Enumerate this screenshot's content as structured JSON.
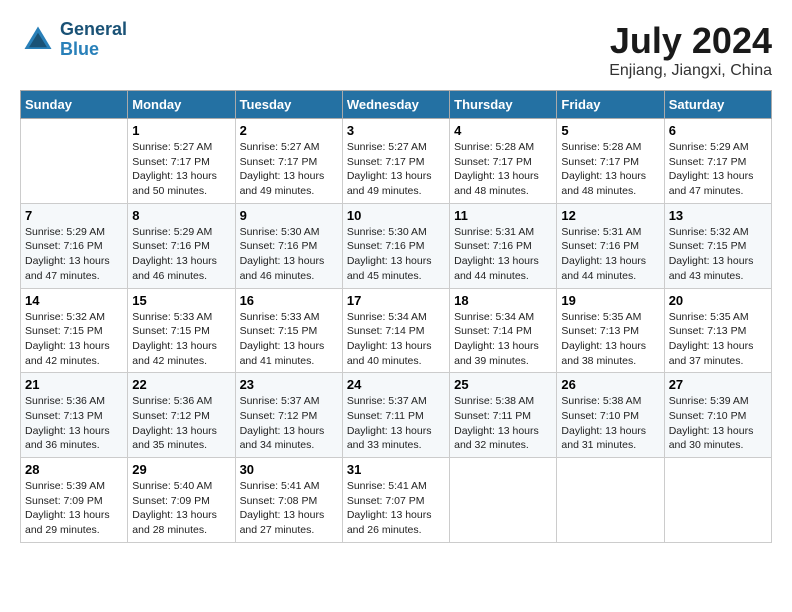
{
  "header": {
    "logo_line1": "General",
    "logo_line2": "Blue",
    "month": "July 2024",
    "location": "Enjiang, Jiangxi, China"
  },
  "weekdays": [
    "Sunday",
    "Monday",
    "Tuesday",
    "Wednesday",
    "Thursday",
    "Friday",
    "Saturday"
  ],
  "weeks": [
    [
      {
        "day": "",
        "empty": true
      },
      {
        "day": "1",
        "sunrise": "Sunrise: 5:27 AM",
        "sunset": "Sunset: 7:17 PM",
        "daylight": "Daylight: 13 hours and 50 minutes."
      },
      {
        "day": "2",
        "sunrise": "Sunrise: 5:27 AM",
        "sunset": "Sunset: 7:17 PM",
        "daylight": "Daylight: 13 hours and 49 minutes."
      },
      {
        "day": "3",
        "sunrise": "Sunrise: 5:27 AM",
        "sunset": "Sunset: 7:17 PM",
        "daylight": "Daylight: 13 hours and 49 minutes."
      },
      {
        "day": "4",
        "sunrise": "Sunrise: 5:28 AM",
        "sunset": "Sunset: 7:17 PM",
        "daylight": "Daylight: 13 hours and 48 minutes."
      },
      {
        "day": "5",
        "sunrise": "Sunrise: 5:28 AM",
        "sunset": "Sunset: 7:17 PM",
        "daylight": "Daylight: 13 hours and 48 minutes."
      },
      {
        "day": "6",
        "sunrise": "Sunrise: 5:29 AM",
        "sunset": "Sunset: 7:17 PM",
        "daylight": "Daylight: 13 hours and 47 minutes."
      }
    ],
    [
      {
        "day": "7",
        "sunrise": "Sunrise: 5:29 AM",
        "sunset": "Sunset: 7:16 PM",
        "daylight": "Daylight: 13 hours and 47 minutes."
      },
      {
        "day": "8",
        "sunrise": "Sunrise: 5:29 AM",
        "sunset": "Sunset: 7:16 PM",
        "daylight": "Daylight: 13 hours and 46 minutes."
      },
      {
        "day": "9",
        "sunrise": "Sunrise: 5:30 AM",
        "sunset": "Sunset: 7:16 PM",
        "daylight": "Daylight: 13 hours and 46 minutes."
      },
      {
        "day": "10",
        "sunrise": "Sunrise: 5:30 AM",
        "sunset": "Sunset: 7:16 PM",
        "daylight": "Daylight: 13 hours and 45 minutes."
      },
      {
        "day": "11",
        "sunrise": "Sunrise: 5:31 AM",
        "sunset": "Sunset: 7:16 PM",
        "daylight": "Daylight: 13 hours and 44 minutes."
      },
      {
        "day": "12",
        "sunrise": "Sunrise: 5:31 AM",
        "sunset": "Sunset: 7:16 PM",
        "daylight": "Daylight: 13 hours and 44 minutes."
      },
      {
        "day": "13",
        "sunrise": "Sunrise: 5:32 AM",
        "sunset": "Sunset: 7:15 PM",
        "daylight": "Daylight: 13 hours and 43 minutes."
      }
    ],
    [
      {
        "day": "14",
        "sunrise": "Sunrise: 5:32 AM",
        "sunset": "Sunset: 7:15 PM",
        "daylight": "Daylight: 13 hours and 42 minutes."
      },
      {
        "day": "15",
        "sunrise": "Sunrise: 5:33 AM",
        "sunset": "Sunset: 7:15 PM",
        "daylight": "Daylight: 13 hours and 42 minutes."
      },
      {
        "day": "16",
        "sunrise": "Sunrise: 5:33 AM",
        "sunset": "Sunset: 7:15 PM",
        "daylight": "Daylight: 13 hours and 41 minutes."
      },
      {
        "day": "17",
        "sunrise": "Sunrise: 5:34 AM",
        "sunset": "Sunset: 7:14 PM",
        "daylight": "Daylight: 13 hours and 40 minutes."
      },
      {
        "day": "18",
        "sunrise": "Sunrise: 5:34 AM",
        "sunset": "Sunset: 7:14 PM",
        "daylight": "Daylight: 13 hours and 39 minutes."
      },
      {
        "day": "19",
        "sunrise": "Sunrise: 5:35 AM",
        "sunset": "Sunset: 7:13 PM",
        "daylight": "Daylight: 13 hours and 38 minutes."
      },
      {
        "day": "20",
        "sunrise": "Sunrise: 5:35 AM",
        "sunset": "Sunset: 7:13 PM",
        "daylight": "Daylight: 13 hours and 37 minutes."
      }
    ],
    [
      {
        "day": "21",
        "sunrise": "Sunrise: 5:36 AM",
        "sunset": "Sunset: 7:13 PM",
        "daylight": "Daylight: 13 hours and 36 minutes."
      },
      {
        "day": "22",
        "sunrise": "Sunrise: 5:36 AM",
        "sunset": "Sunset: 7:12 PM",
        "daylight": "Daylight: 13 hours and 35 minutes."
      },
      {
        "day": "23",
        "sunrise": "Sunrise: 5:37 AM",
        "sunset": "Sunset: 7:12 PM",
        "daylight": "Daylight: 13 hours and 34 minutes."
      },
      {
        "day": "24",
        "sunrise": "Sunrise: 5:37 AM",
        "sunset": "Sunset: 7:11 PM",
        "daylight": "Daylight: 13 hours and 33 minutes."
      },
      {
        "day": "25",
        "sunrise": "Sunrise: 5:38 AM",
        "sunset": "Sunset: 7:11 PM",
        "daylight": "Daylight: 13 hours and 32 minutes."
      },
      {
        "day": "26",
        "sunrise": "Sunrise: 5:38 AM",
        "sunset": "Sunset: 7:10 PM",
        "daylight": "Daylight: 13 hours and 31 minutes."
      },
      {
        "day": "27",
        "sunrise": "Sunrise: 5:39 AM",
        "sunset": "Sunset: 7:10 PM",
        "daylight": "Daylight: 13 hours and 30 minutes."
      }
    ],
    [
      {
        "day": "28",
        "sunrise": "Sunrise: 5:39 AM",
        "sunset": "Sunset: 7:09 PM",
        "daylight": "Daylight: 13 hours and 29 minutes."
      },
      {
        "day": "29",
        "sunrise": "Sunrise: 5:40 AM",
        "sunset": "Sunset: 7:09 PM",
        "daylight": "Daylight: 13 hours and 28 minutes."
      },
      {
        "day": "30",
        "sunrise": "Sunrise: 5:41 AM",
        "sunset": "Sunset: 7:08 PM",
        "daylight": "Daylight: 13 hours and 27 minutes."
      },
      {
        "day": "31",
        "sunrise": "Sunrise: 5:41 AM",
        "sunset": "Sunset: 7:07 PM",
        "daylight": "Daylight: 13 hours and 26 minutes."
      },
      {
        "day": "",
        "empty": true
      },
      {
        "day": "",
        "empty": true
      },
      {
        "day": "",
        "empty": true
      }
    ]
  ]
}
